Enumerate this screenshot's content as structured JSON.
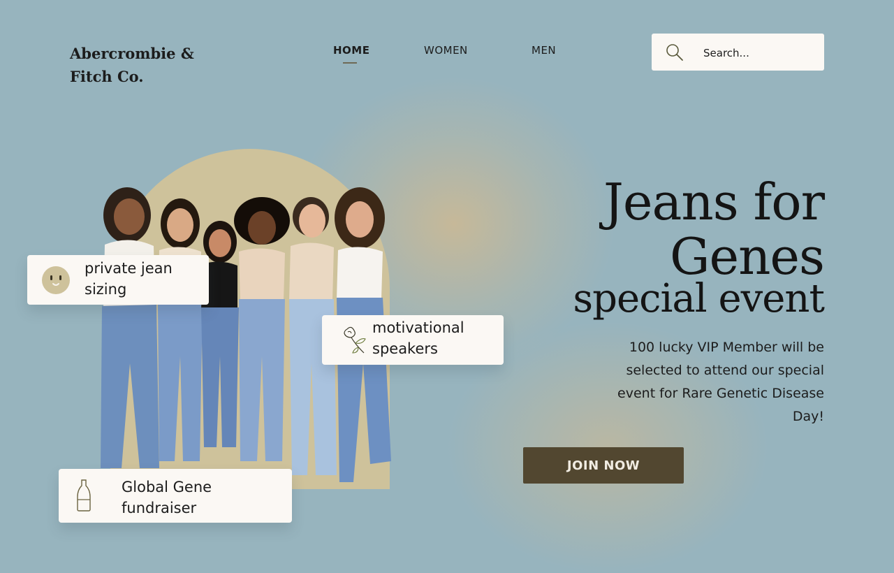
{
  "brand": {
    "name_line1": "Abercrombie &",
    "name_line2": "Fitch Co."
  },
  "nav": {
    "items": [
      "HOME",
      "WOMEN",
      "MEN"
    ],
    "active": "HOME"
  },
  "search": {
    "placeholder": "Search..."
  },
  "hero": {
    "title_line1": "Jeans for",
    "title_line2": "Genes",
    "title_line3": "special event",
    "description": "100 lucky VIP Member will be selected to attend our special event for Rare Genetic Disease Day!",
    "cta_label": "JOIN NOW"
  },
  "features": [
    {
      "label": "private jean\nsizing",
      "icon": "smiley-face-icon"
    },
    {
      "label": "motivational\nspeakers",
      "icon": "rose-flower-icon"
    },
    {
      "label": "Global Gene\nfundraiser",
      "icon": "bottle-icon"
    }
  ],
  "colors": {
    "background": "#97b4be",
    "accent_beige": "#cec29b",
    "cta": "#524730",
    "card": "#fbf8f4"
  }
}
